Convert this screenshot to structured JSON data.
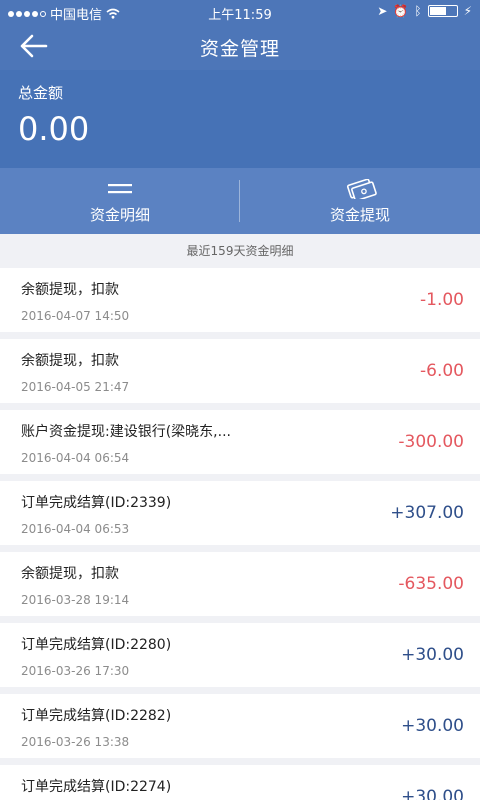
{
  "status_bar": {
    "carrier": "中国电信",
    "time": "上午11:59"
  },
  "nav": {
    "title": "资金管理"
  },
  "total": {
    "label": "总金额",
    "amount": "0.00"
  },
  "actions": [
    {
      "label": "资金明细",
      "icon": "list-icon"
    },
    {
      "label": "资金提现",
      "icon": "cash-icon"
    }
  ],
  "section_caption": "最近159天资金明细",
  "records": [
    {
      "title": "余额提现，扣款",
      "date": "2016-04-07 14:50",
      "amount": "-1.00"
    },
    {
      "title": "余额提现，扣款",
      "date": "2016-04-05 21:47",
      "amount": "-6.00"
    },
    {
      "title": "账户资金提现:建设银行(梁晓东,...",
      "date": "2016-04-04 06:54",
      "amount": "-300.00"
    },
    {
      "title": "订单完成结算(ID:2339)",
      "date": "2016-04-04 06:53",
      "amount": "+307.00"
    },
    {
      "title": "余额提现，扣款",
      "date": "2016-03-28 19:14",
      "amount": "-635.00"
    },
    {
      "title": "订单完成结算(ID:2280)",
      "date": "2016-03-26 17:30",
      "amount": "+30.00"
    },
    {
      "title": "订单完成结算(ID:2282)",
      "date": "2016-03-26 13:38",
      "amount": "+30.00"
    },
    {
      "title": "订单完成结算(ID:2274)",
      "date": "",
      "amount": "+30.00"
    }
  ],
  "colors": {
    "header": "#4d76b8",
    "negative": "#e4585f",
    "positive": "#2f4f8a"
  }
}
